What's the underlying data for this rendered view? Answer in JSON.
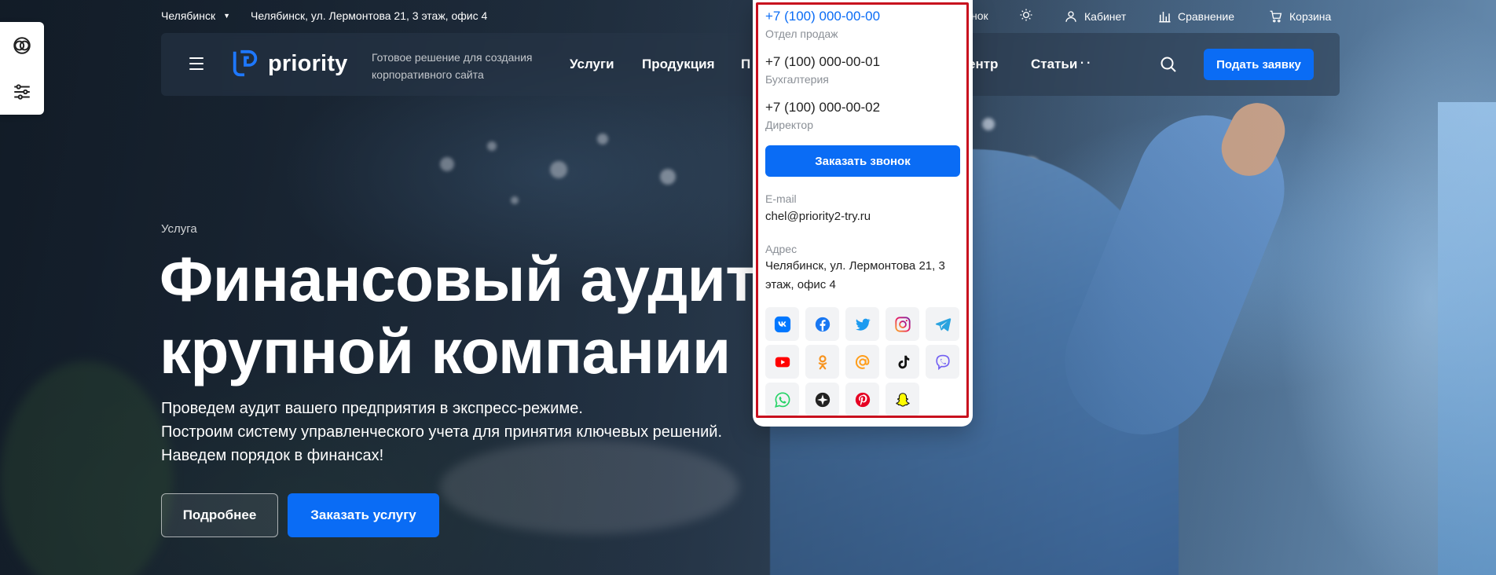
{
  "topbar": {
    "city": "Челябинск",
    "address": "Челябинск, ул. Лермонтова 21, 3 этаж, офис 4",
    "callback_partial": "нок",
    "cabinet": "Кабинет",
    "compare": "Сравнение",
    "cart": "Корзина"
  },
  "header": {
    "logo_text": "priority",
    "tagline": "Готовое решение для создания корпоративного сайта",
    "nav": [
      "Услуги",
      "Продукция",
      "П",
      "ентр",
      "Статьи"
    ],
    "apply_button": "Подать заявку"
  },
  "hero": {
    "kicker": "Услуга",
    "title_line1": "Финансовый аудит",
    "title_line2": "крупной компании",
    "desc_line1": "Проведем аудит вашего предприятия в экспресс-режиме.",
    "desc_line2": "Построим систему управленческого учета для принятия ключевых решений.",
    "desc_line3": "Наведем порядок в финансах!",
    "btn_more": "Подробнее",
    "btn_order": "Заказать услугу"
  },
  "contacts": {
    "phones": [
      {
        "number": "+7 (100) 000-00-00",
        "label": "Отдел продаж"
      },
      {
        "number": "+7 (100) 000-00-01",
        "label": "Бухгалтерия"
      },
      {
        "number": "+7 (100) 000-00-02",
        "label": "Директор"
      }
    ],
    "callback_button": "Заказать звонок",
    "email_label": "E-mail",
    "email": "chel@priority2-try.ru",
    "address_label": "Адрес",
    "address": "Челябинск, ул. Лермонтова 21, 3 этаж, офис 4"
  },
  "socials": [
    "vk-icon",
    "facebook-icon",
    "twitter-icon",
    "instagram-icon",
    "telegram-icon",
    "youtube-icon",
    "odnoklassniki-icon",
    "mail-icon",
    "tiktok-icon",
    "viber-icon",
    "whatsapp-icon",
    "livejournal-icon",
    "pinterest-icon",
    "snapchat-icon"
  ],
  "colors": {
    "accent": "#0a6cf5",
    "highlight_frame": "#c8101e"
  }
}
